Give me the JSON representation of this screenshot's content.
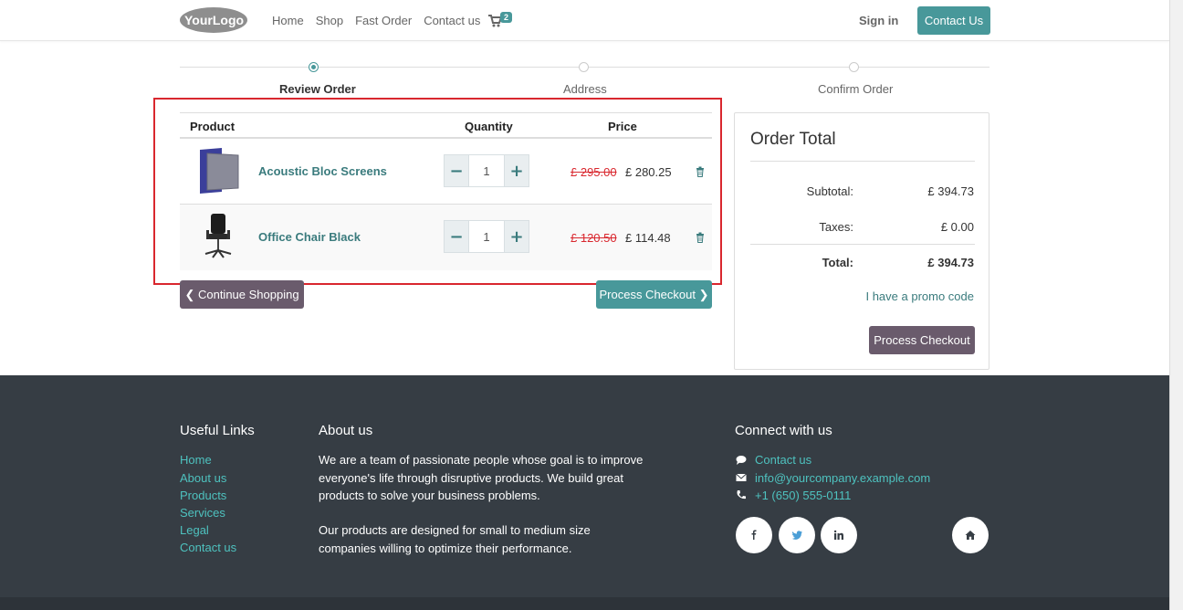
{
  "header": {
    "logo_text": "YourLogo",
    "nav": [
      "Home",
      "Shop",
      "Fast Order",
      "Contact us"
    ],
    "cart_count": "2",
    "sign_in": "Sign in",
    "contact_button": "Contact Us"
  },
  "steps": {
    "items": [
      "Review Order",
      "Address",
      "Confirm Order"
    ],
    "active": "Review Order"
  },
  "cart": {
    "columns": [
      "Product",
      "Quantity",
      "Price"
    ],
    "items": [
      {
        "name": "Acoustic Bloc Screens",
        "quantity": "1",
        "old_price": "£ 295.00",
        "price": "£ 280.25",
        "decrease": "−",
        "increase": "+"
      },
      {
        "name": "Office Chair Black",
        "quantity": "1",
        "old_price": "£ 120.50",
        "price": "£ 114.48",
        "decrease": "−",
        "increase": "+"
      }
    ],
    "continue_label": "Continue Shopping",
    "process_label": "Process Checkout"
  },
  "order_total": {
    "title": "Order Total",
    "subtotal_label": "Subtotal:",
    "subtotal": "£ 394.73",
    "taxes_label": "Taxes:",
    "taxes": "£ 0.00",
    "total_label": "Total:",
    "total": "£ 394.73",
    "promo": "I have a promo code",
    "process_label": "Process Checkout"
  },
  "footer": {
    "useful_links_title": "Useful Links",
    "useful_links": [
      "Home",
      "About us",
      "Products",
      "Services",
      "Legal",
      "Contact us"
    ],
    "about_title": "About us",
    "about_p1": "We are a team of passionate people whose goal is to improve everyone's life through disruptive products. We build great products to solve your business problems.",
    "about_p2": "Our products are designed for small to medium size companies willing to optimize their performance.",
    "connect_title": "Connect with us",
    "contact_link": "Contact us",
    "email": "info@yourcompany.example.com",
    "phone": "+1 (650) 555-0111"
  },
  "colors": {
    "accent": "#48989a",
    "secondary": "#6a5b6c",
    "footer_bg": "#363d44",
    "footer_link": "#4ec2bf",
    "highlight": "#d9272e"
  }
}
